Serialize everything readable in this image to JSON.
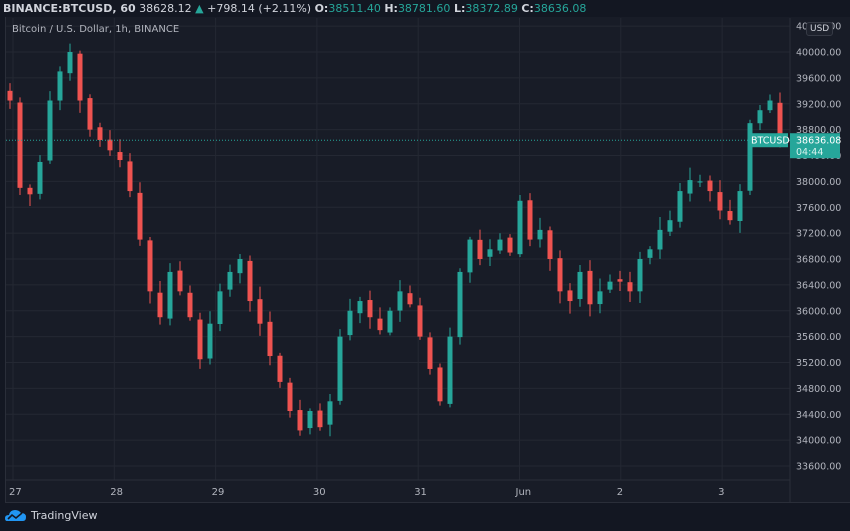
{
  "header": {
    "symbol": "BINANCE:BTCUSD, 60",
    "last": "38628.12",
    "change": "+798.14 (+2.11%)",
    "o_label": "O:",
    "o": "38511.40",
    "h_label": "H:",
    "h": "38781.60",
    "l_label": "L:",
    "l": "38372.89",
    "c_label": "C:",
    "c": "38636.08"
  },
  "subtitle": "Bitcoin / U.S. Dollar, 1h, BINANCE",
  "currency_button": "USD",
  "price_label": {
    "symbol": "BTCUSD",
    "price": "38636.08",
    "countdown": "04:44"
  },
  "footer": {
    "brand": "TradingView"
  },
  "colors": {
    "up": "#26a69a",
    "down": "#ef5350",
    "grid": "#242833",
    "bg": "#181c27"
  },
  "chart_data": {
    "type": "candlestick",
    "y_ticks": [
      40400,
      40000,
      39600,
      39200,
      38800,
      38400,
      38000,
      37600,
      37200,
      36800,
      36400,
      36000,
      35600,
      35200,
      34800,
      34400,
      34000,
      33600
    ],
    "y_tick_labels": [
      "40400.00",
      "40000.00",
      "39600.00",
      "39200.00",
      "38800.00",
      "38400.00",
      "38000.00",
      "37600.00",
      "37200.00",
      "36800.00",
      "36400.00",
      "36000.00",
      "35600.00",
      "35200.00",
      "34800.00",
      "34400.00",
      "34000.00",
      "33600.00"
    ],
    "x_ticks": [
      "27",
      "28",
      "29",
      "30",
      "31",
      "Jun",
      "2",
      "3"
    ],
    "current_price": 38636.08,
    "closes": [
      39250,
      37900,
      37800,
      38300,
      39250,
      39700,
      40000,
      39250,
      38800,
      38640,
      38480,
      38330,
      37850,
      37100,
      36300,
      35900,
      36600,
      36300,
      35900,
      35250,
      35800,
      36300,
      36600,
      36800,
      36150,
      35800,
      35300,
      34900,
      34450,
      34150,
      34450,
      34200,
      34600,
      35600,
      36000,
      36150,
      35900,
      35700,
      36000,
      36300,
      36100,
      35600,
      35100,
      34600,
      35600,
      36600,
      37100,
      36800,
      36950,
      37100,
      36900,
      37700,
      37100,
      37250,
      36800,
      36300,
      36150,
      36600,
      36100,
      36300,
      36450,
      36450,
      36300,
      36800,
      36950,
      37250,
      37400,
      37850,
      38020,
      38000,
      37850,
      37550,
      37400,
      37850,
      38900,
      39100,
      39250,
      38636
    ]
  }
}
